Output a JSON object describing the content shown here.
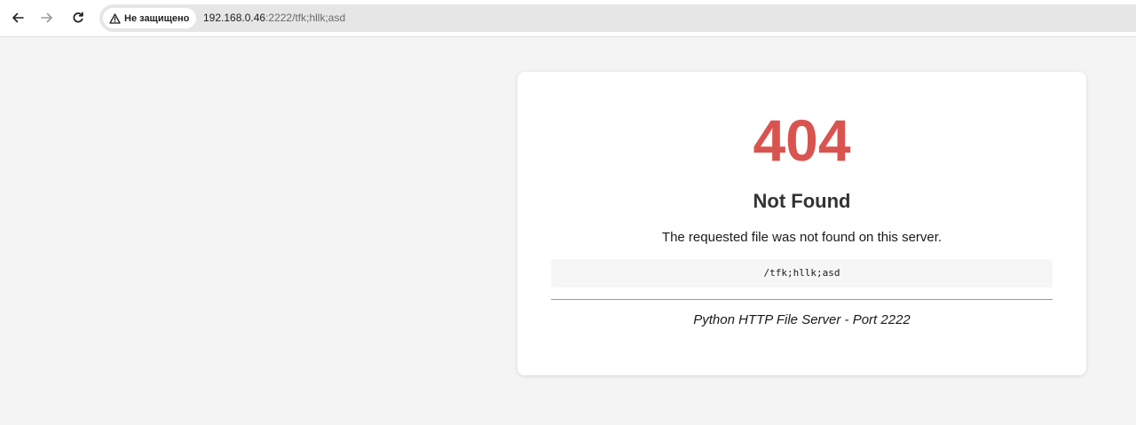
{
  "browser": {
    "back_icon": "arrow-left-icon",
    "forward_icon": "arrow-right-icon",
    "reload_icon": "reload-icon",
    "security": {
      "icon": "warning-triangle-icon",
      "label": "Не защищено"
    },
    "url": {
      "host": "192.168.0.46",
      "rest": ":2222/tfk;hllk;asd"
    }
  },
  "page": {
    "status_code": "404",
    "status_color": "#d9534f",
    "title": "Not Found",
    "message": "The requested file was not found on this server.",
    "requested_path": "/tfk;hllk;asd",
    "footer": "Python HTTP File Server - Port 2222"
  }
}
